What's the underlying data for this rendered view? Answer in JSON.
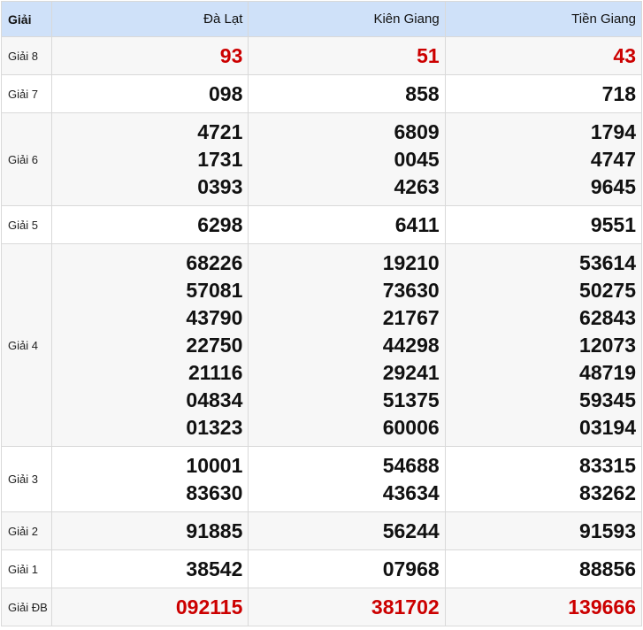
{
  "header": {
    "prize_label": "Giải",
    "provinces": [
      "Đà Lạt",
      "Kiên Giang",
      "Tiền Giang"
    ]
  },
  "rows": [
    {
      "label": "Giải 8",
      "cells": [
        [
          "93"
        ],
        [
          "51"
        ],
        [
          "43"
        ]
      ]
    },
    {
      "label": "Giải 7",
      "cells": [
        [
          "098"
        ],
        [
          "858"
        ],
        [
          "718"
        ]
      ]
    },
    {
      "label": "Giải 6",
      "cells": [
        [
          "4721",
          "1731",
          "0393"
        ],
        [
          "6809",
          "0045",
          "4263"
        ],
        [
          "1794",
          "4747",
          "9645"
        ]
      ]
    },
    {
      "label": "Giải 5",
      "cells": [
        [
          "6298"
        ],
        [
          "6411"
        ],
        [
          "9551"
        ]
      ]
    },
    {
      "label": "Giải 4",
      "cells": [
        [
          "68226",
          "57081",
          "43790",
          "22750",
          "21116",
          "04834",
          "01323"
        ],
        [
          "19210",
          "73630",
          "21767",
          "44298",
          "29241",
          "51375",
          "60006"
        ],
        [
          "53614",
          "50275",
          "62843",
          "12073",
          "48719",
          "59345",
          "03194"
        ]
      ]
    },
    {
      "label": "Giải 3",
      "cells": [
        [
          "10001",
          "83630"
        ],
        [
          "54688",
          "43634"
        ],
        [
          "83315",
          "83262"
        ]
      ]
    },
    {
      "label": "Giải 2",
      "cells": [
        [
          "91885"
        ],
        [
          "56244"
        ],
        [
          "91593"
        ]
      ]
    },
    {
      "label": "Giải 1",
      "cells": [
        [
          "38542"
        ],
        [
          "07968"
        ],
        [
          "88856"
        ]
      ]
    },
    {
      "label": "Giải ĐB",
      "cells": [
        [
          "092115"
        ],
        [
          "381702"
        ],
        [
          "139666"
        ]
      ]
    }
  ],
  "colors": {
    "header_bg": "#cfe1f9",
    "highlight_red": "#cc0000",
    "alt_row_bg": "#f7f7f7"
  }
}
